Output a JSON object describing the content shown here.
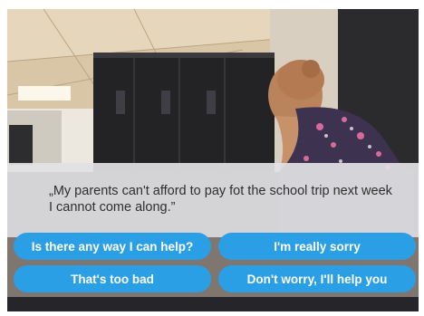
{
  "dialog": {
    "text": "„My parents can't afford to pay fot the school trip next week I cannot come along.”"
  },
  "choices": [
    "Is there any way I can help?",
    "I'm really sorry",
    "That's too bad",
    "Don't worry, I'll help you"
  ],
  "colors": {
    "choice_button": "#2a9fe6",
    "dialog_box": "#e1e1e4",
    "dialog_text": "#2f2f2f"
  }
}
